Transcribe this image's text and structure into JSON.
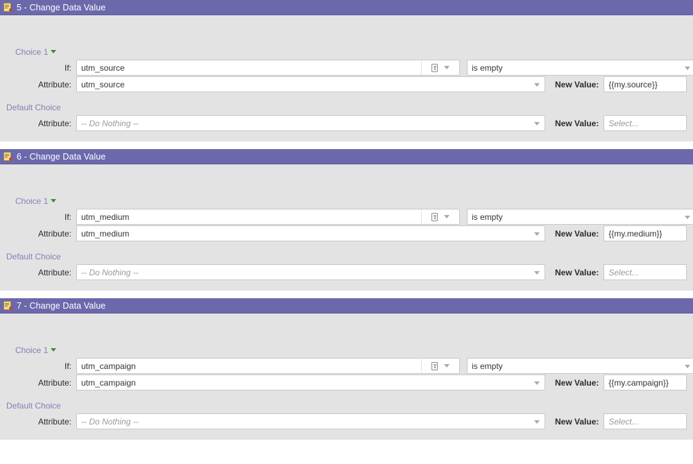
{
  "theme": {
    "header_bg": "#6B68AC",
    "body_bg": "#E3E3E3",
    "label_purple": "#8480B5",
    "caret_green": "#3E8A33"
  },
  "labels": {
    "if": "If:",
    "attribute": "Attribute:",
    "new_value": "New Value:",
    "choice": "Choice 1",
    "default_choice": "Default Choice",
    "do_nothing": "-- Do Nothing --",
    "select_placeholder": "Select...",
    "condition": "is empty"
  },
  "icons": {
    "step": "change-data-value-icon",
    "token_picker": "book-icon",
    "dropdown": "chevron-down-icon",
    "choice_toggle": "caret-down-icon"
  },
  "steps": [
    {
      "number": "5",
      "title": "5 - Change Data Value",
      "choice_label": "Choice 1",
      "if_value": "utm_source",
      "condition": "is empty",
      "attribute_value": "utm_source",
      "new_value": "{{my.source}}",
      "default_label": "Default Choice",
      "default_attribute": "-- Do Nothing --",
      "default_new_value": "Select..."
    },
    {
      "number": "6",
      "title": "6 - Change Data Value",
      "choice_label": "Choice 1",
      "if_value": "utm_medium",
      "condition": "is empty",
      "attribute_value": "utm_medium",
      "new_value": "{{my.medium}}",
      "default_label": "Default Choice",
      "default_attribute": "-- Do Nothing --",
      "default_new_value": "Select..."
    },
    {
      "number": "7",
      "title": "7 - Change Data Value",
      "choice_label": "Choice 1",
      "if_value": "utm_campaign",
      "condition": "is empty",
      "attribute_value": "utm_campaign",
      "new_value": "{{my.campaign}}",
      "default_label": "Default Choice",
      "default_attribute": "-- Do Nothing --",
      "default_new_value": "Select..."
    }
  ]
}
